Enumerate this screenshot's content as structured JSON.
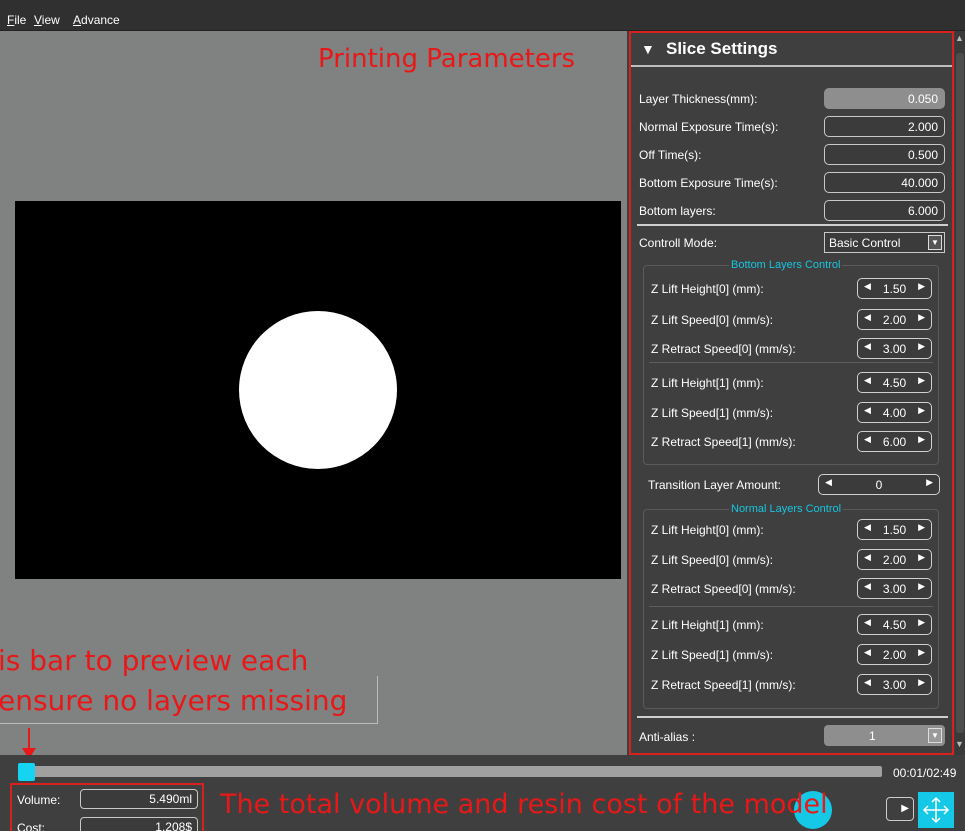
{
  "menu": {
    "items": [
      "File",
      "View",
      "Advance"
    ],
    "accelerators": [
      "F",
      "V",
      "A"
    ]
  },
  "annotations": {
    "printing_parameters": "Printing Parameters",
    "preview_line1": "is bar to preview each",
    "preview_line2": "ensure no layers missing",
    "total": "The total volume and resin cost of the model"
  },
  "slice_settings": {
    "title": "Slice Settings",
    "layer_thickness": {
      "label": "Layer Thickness(mm):",
      "value": "0.050"
    },
    "normal_exposure": {
      "label": "Normal Exposure Time(s):",
      "value": "2.000"
    },
    "off_time": {
      "label": "Off Time(s):",
      "value": "0.500"
    },
    "bottom_exposure": {
      "label": "Bottom Exposure Time(s):",
      "value": "40.000"
    },
    "bottom_layers": {
      "label": "Bottom layers:",
      "value": "6.000"
    },
    "control_mode": {
      "label": "Controll Mode:",
      "value": "Basic Control"
    },
    "bottom_group": {
      "title": "Bottom Layers Control",
      "rows": [
        {
          "label": "Z Lift Height[0] (mm):",
          "value": "1.50"
        },
        {
          "label": "Z Lift Speed[0] (mm/s):",
          "value": "2.00"
        },
        {
          "label": "Z Retract Speed[0] (mm/s):",
          "value": "3.00"
        },
        {
          "label": "Z Lift Height[1] (mm):",
          "value": "4.50"
        },
        {
          "label": "Z Lift Speed[1] (mm/s):",
          "value": "4.00"
        },
        {
          "label": "Z Retract Speed[1] (mm/s):",
          "value": "6.00"
        }
      ]
    },
    "transition": {
      "label": "Transition Layer Amount:",
      "value": "0"
    },
    "normal_group": {
      "title": "Normal Layers Control",
      "rows": [
        {
          "label": "Z Lift Height[0] (mm):",
          "value": "1.50"
        },
        {
          "label": "Z Lift Speed[0] (mm/s):",
          "value": "2.00"
        },
        {
          "label": "Z Retract Speed[0] (mm/s):",
          "value": "3.00"
        },
        {
          "label": "Z Lift Height[1] (mm):",
          "value": "4.50"
        },
        {
          "label": "Z Lift Speed[1] (mm/s):",
          "value": "2.00"
        },
        {
          "label": "Z Retract Speed[1] (mm/s):",
          "value": "3.00"
        }
      ]
    },
    "anti_alias": {
      "label": "Anti-alias :",
      "value": "1"
    }
  },
  "layer_slider": {
    "time": "00:01/02:49",
    "progress_fraction": 0.0
  },
  "stats": {
    "volume": {
      "label": "Volume:",
      "value": "5.490ml"
    },
    "cost": {
      "label": "Cost:",
      "value": "1.208$"
    }
  },
  "colors": {
    "accent": "#15c9e6",
    "annotation_red": "#e81818",
    "group_title": "#16c5e0"
  }
}
